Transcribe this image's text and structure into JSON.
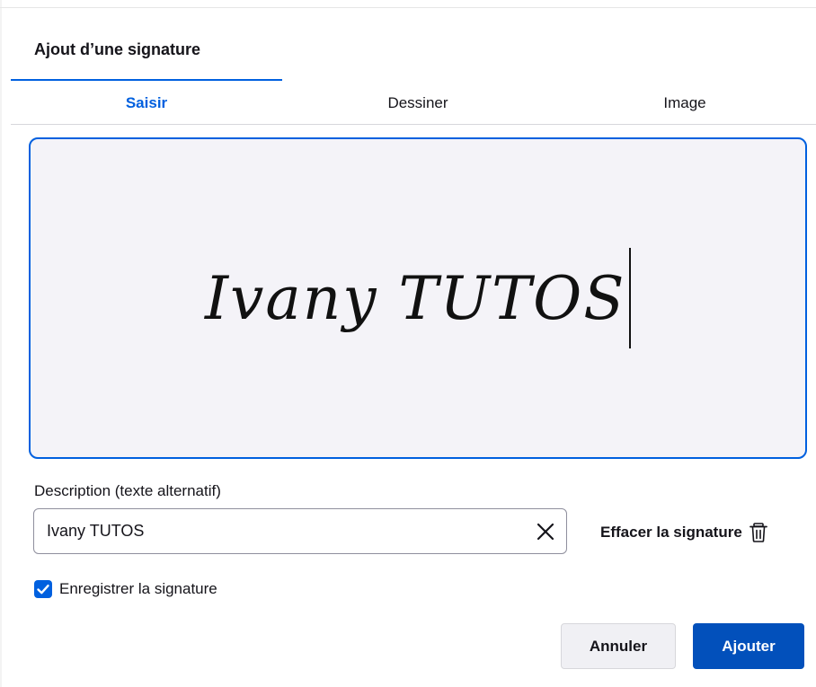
{
  "dialog": {
    "title": "Ajout d’une signature"
  },
  "tabs": [
    {
      "label": "Saisir",
      "active": true
    },
    {
      "label": "Dessiner",
      "active": false
    },
    {
      "label": "Image",
      "active": false
    }
  ],
  "signature": {
    "text": "Ivany TUTOS"
  },
  "description": {
    "label": "Description (texte alternatif)",
    "value": "Ivany TUTOS",
    "clear_icon": "close-icon"
  },
  "erase": {
    "label": "Effacer la signature",
    "icon": "trash-icon"
  },
  "save": {
    "label": "Enregistrer la signature",
    "checked": true
  },
  "buttons": {
    "cancel": "Annuler",
    "add": "Ajouter"
  },
  "colors": {
    "accent": "#0060df",
    "primary_button": "#0250bb",
    "canvas_bg": "#f4f3f8"
  }
}
